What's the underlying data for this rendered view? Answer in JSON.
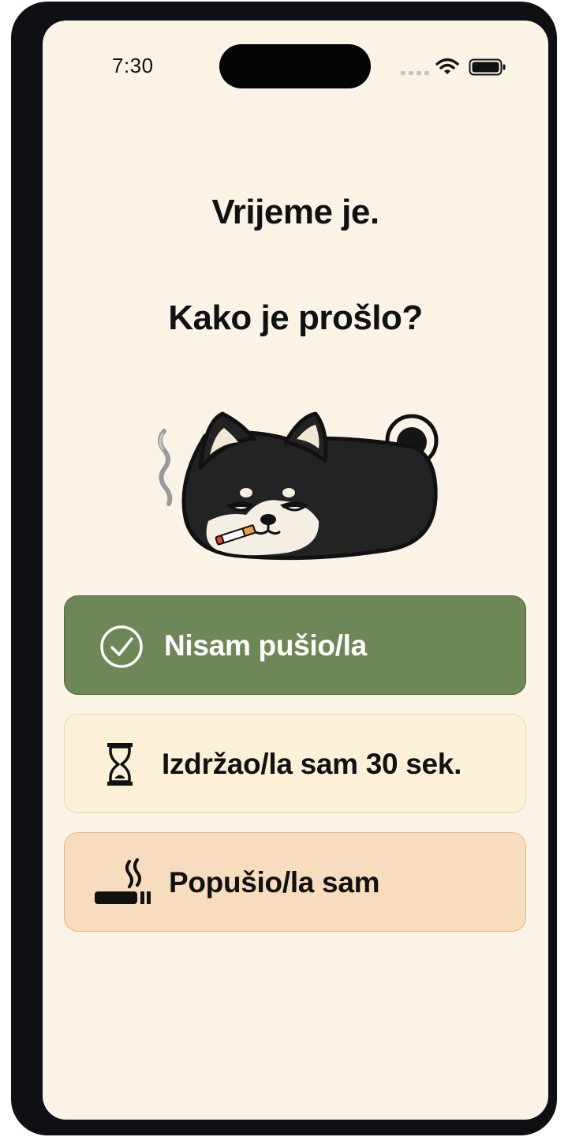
{
  "status_bar": {
    "time": "7:30",
    "icons": [
      "signal-icon",
      "wifi-icon",
      "battery-icon"
    ]
  },
  "prompt": {
    "line1": "Vrijeme je.",
    "line2": "Kako je prošlo?"
  },
  "mascot": {
    "name": "smoking-shiba-mascot"
  },
  "options": [
    {
      "label": "Nisam pušio/la",
      "icon": "check-circle-icon",
      "color": "#6e8757"
    },
    {
      "label": "Izdržao/la sam 30 sek.",
      "icon": "hourglass-icon",
      "color": "#fdf0d8"
    },
    {
      "label": "Popušio/la sam",
      "icon": "cigarette-icon",
      "color": "#f7ddbe"
    }
  ],
  "colors": {
    "background": "#faf3e6",
    "frame": "#0f1013",
    "text": "#111111"
  }
}
